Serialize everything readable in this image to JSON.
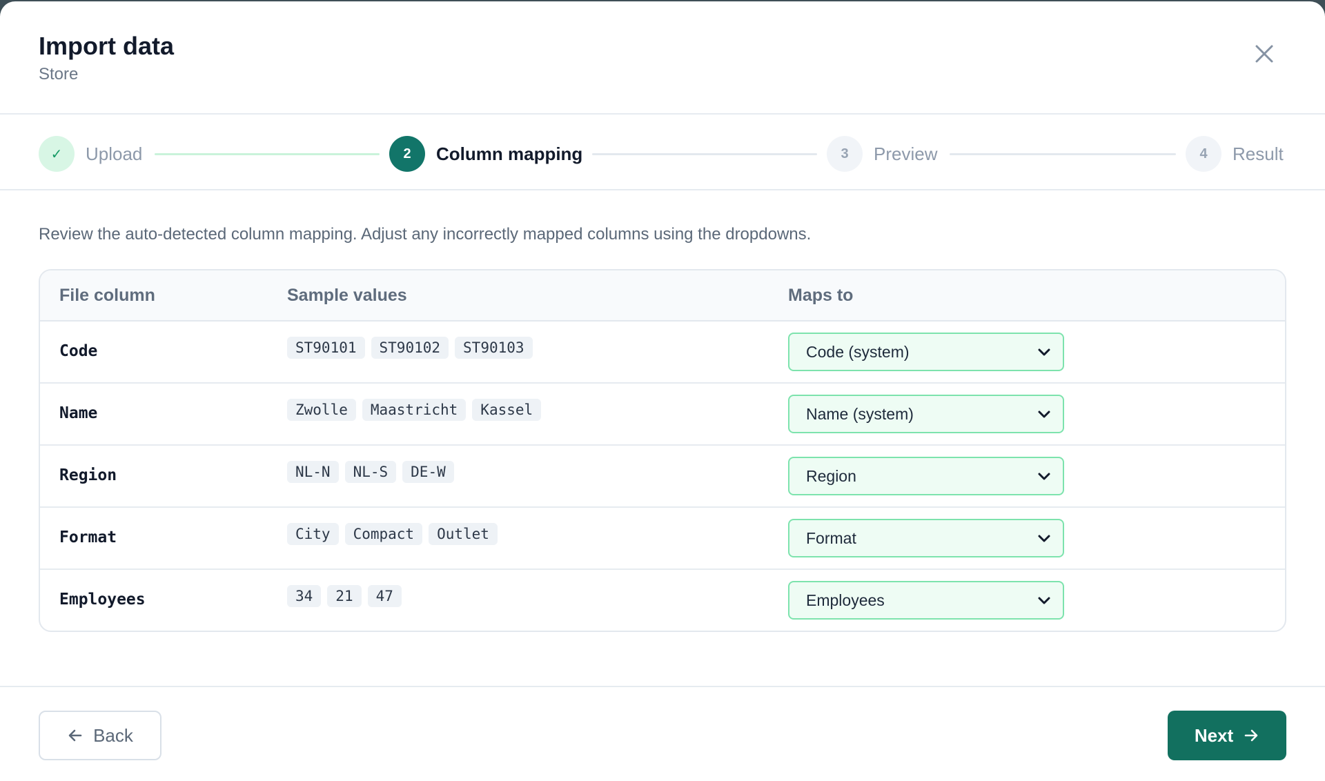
{
  "dialog": {
    "title": "Import data",
    "subtitle": "Store",
    "close_icon": "close-icon"
  },
  "stepper": {
    "steps": [
      {
        "number": "✓",
        "label": "Upload",
        "state": "complete"
      },
      {
        "number": "2",
        "label": "Column mapping",
        "state": "active"
      },
      {
        "number": "3",
        "label": "Preview",
        "state": "upcoming"
      },
      {
        "number": "4",
        "label": "Result",
        "state": "upcoming"
      }
    ]
  },
  "instructions": "Review the auto-detected column mapping. Adjust any incorrectly mapped columns using the dropdowns.",
  "table": {
    "headers": [
      "File column",
      "Sample values",
      "Maps to"
    ],
    "rows": [
      {
        "column": "Code",
        "samples": [
          "ST90101",
          "ST90102",
          "ST90103"
        ],
        "maps_to": "Code (system)"
      },
      {
        "column": "Name",
        "samples": [
          "Zwolle",
          "Maastricht",
          "Kassel"
        ],
        "maps_to": "Name (system)"
      },
      {
        "column": "Region",
        "samples": [
          "NL-N",
          "NL-S",
          "DE-W"
        ],
        "maps_to": "Region"
      },
      {
        "column": "Format",
        "samples": [
          "City",
          "Compact",
          "Outlet"
        ],
        "maps_to": "Format"
      },
      {
        "column": "Employees",
        "samples": [
          "34",
          "21",
          "47"
        ],
        "maps_to": "Employees"
      }
    ]
  },
  "footer": {
    "back_label": "Back",
    "next_label": "Next"
  },
  "colors": {
    "primary": "#12705f",
    "complete_bg": "#d8f6e5",
    "select_border": "#7de3ad",
    "select_bg": "#eefcf4"
  }
}
